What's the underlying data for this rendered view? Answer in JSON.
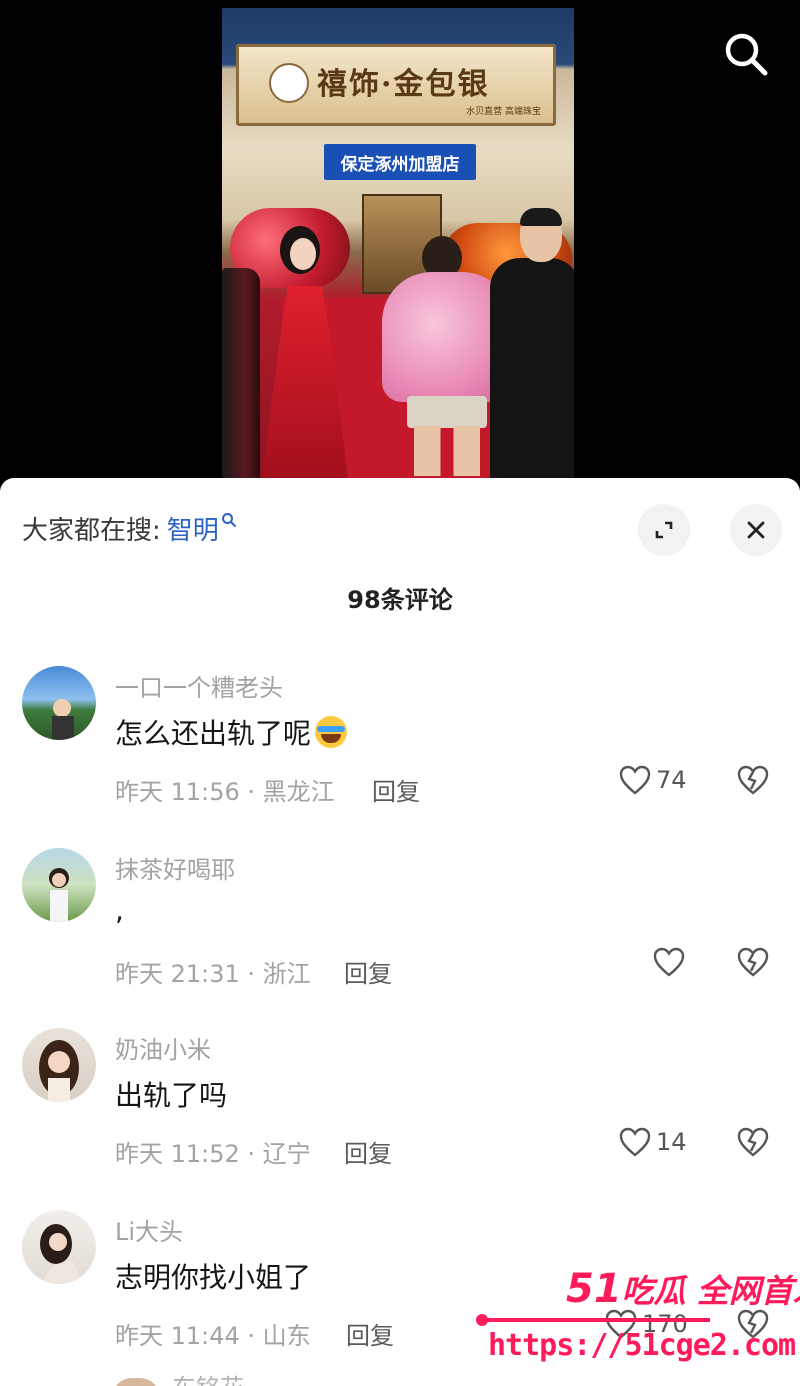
{
  "video": {
    "store_name": "禧饰·金包银",
    "store_subtitle": "水贝直营 高端珠宝",
    "branch_sign": "保定涿州加盟店"
  },
  "search": {
    "icon": "search-icon"
  },
  "sheet": {
    "trending_label": "大家都在搜:",
    "trending_term": "智明",
    "comment_count": "98条评论",
    "expand_icon": "expand-icon",
    "close_icon": "close-icon"
  },
  "comments": [
    {
      "username": "一口一个糟老头",
      "content": "怎么还出轨了呢",
      "has_emoji": true,
      "meta": "昨天 11:56 · 黑龙江",
      "reply": "回复",
      "likes": "74"
    },
    {
      "username": "抹茶好喝耶",
      "content": ",",
      "meta": "昨天 21:31 · 浙江",
      "reply": "回复",
      "likes": ""
    },
    {
      "username": "奶油小米",
      "content": "出轨了吗",
      "meta": "昨天 11:52 · 辽宁",
      "reply": "回复",
      "likes": "14"
    },
    {
      "username": "Li大头",
      "content": "志明你找小姐了",
      "meta": "昨天 11:44 · 山东",
      "reply": "回复",
      "likes": "170"
    }
  ],
  "partial_comment": {
    "username": "东铭花"
  },
  "watermark": {
    "brand_number": "51",
    "brand_text": "吃瓜 全网首发",
    "url": "https://51cge2.com"
  },
  "colors": {
    "accent_link": "#2b62c4",
    "watermark": "#ff1a5a",
    "muted_text": "#a3a3a3"
  }
}
